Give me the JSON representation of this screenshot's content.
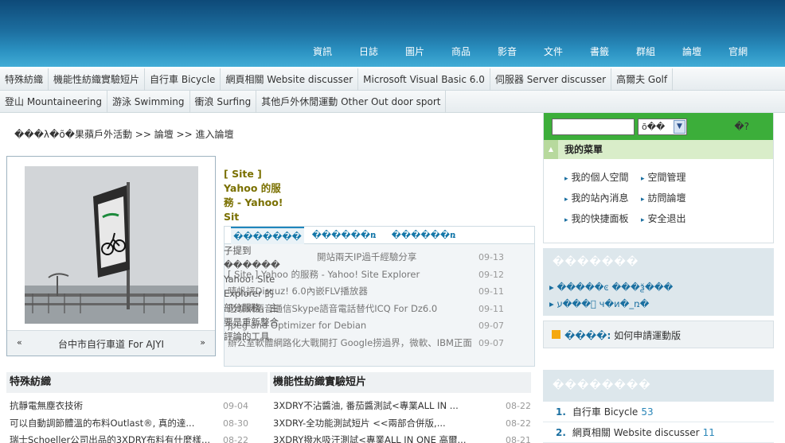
{
  "topnav": [
    "資訊",
    "日誌",
    "圖片",
    "商品",
    "影音",
    "文件",
    "書籤",
    "群組",
    "論壇",
    "官網"
  ],
  "categories_row1": [
    "特殊紡織",
    "機能性紡織實驗短片",
    "自行車 Bicycle",
    "網頁相關 Website discusser",
    "Microsoft Visual Basic 6.0",
    "伺服器 Server discusser",
    "高爾夫 Golf"
  ],
  "categories_row2": [
    "登山 Mountaineering",
    "游泳 Swimming",
    "衝浪 Surfing",
    "其他戶外休閒運動 Other Out door sport"
  ],
  "breadcrumb": "���λ�õ�果蘋戶外活動 >> 論壇 >> 進入論壇",
  "slideshow": {
    "prev": "«",
    "next": "»",
    "caption": "台中市自行車道 For AJYI"
  },
  "featured": {
    "line1": "[ Site ]",
    "line2": "Yahoo 的服",
    "line3": "務 - Yahoo!",
    "line4": "Sit"
  },
  "tabbox": {
    "tabs": [
      "�������",
      "������ռ",
      "������ռ"
    ],
    "overlap": [
      "子提到������",
      "Yahoo! Site",
      "Explorer 的",
      "部分服務，主",
      "要是重新整合",
      "評論的工具"
    ],
    "items": [
      {
        "title": "開站兩天IP過千經驗分享",
        "date": "09-13"
      },
      {
        "title": "[ Site ] Yahoo 的服務 - Yahoo! Site Explorer",
        "date": "09-12"
      },
      {
        "title": "晴帆評Discuz! 6.0內嵌FLV播放器",
        "date": "09-11"
      },
      {
        "title": "迅聊網語音通信Skype語音電話替代ICQ For Dz6.0",
        "date": "09-11"
      },
      {
        "title": "Jpeg and Optimizer for Debian",
        "date": "09-07"
      },
      {
        "title": "辦公室軟體網路化大戰開打 Google捞過界，微軟、IBM正面",
        "date": "09-07"
      }
    ]
  },
  "list_left": {
    "header": "特殊紡織",
    "items": [
      {
        "title": "抗靜電無塵衣技術",
        "date": "09-04"
      },
      {
        "title": "可以自動調節體溫的布料Outlast®, 真的達...",
        "date": "08-30"
      },
      {
        "title": "瑞士Schoeller公司出品的3XDRY布料有什麼樣...",
        "date": "08-22"
      }
    ]
  },
  "list_right": {
    "header": "機能性紡織實驗短片",
    "items": [
      {
        "title": "3XDRY不沾醬油, 番茄醬測試<專業ALL IN ...",
        "date": "08-22"
      },
      {
        "title": "3XDRY-全功能測試短片 <<兩部合併版,...",
        "date": "08-22"
      },
      {
        "title": "3XDRY撥水吸汗測試<專業ALL IN ONE 高爾...",
        "date": "08-21"
      }
    ]
  },
  "sidebar": {
    "search_select": "õ��",
    "search_q": "�?",
    "menu_title": "我的菜單",
    "menu_items": [
      "我的個人空間",
      "空間管理",
      "我的站內消息",
      "訪問論壇",
      "我的快捷面板",
      "安全退出"
    ],
    "box2_title": "�������",
    "box2_line1": "�����ͼ ���ѯ���",
    "box2_line2": "ע���ͬ ч�и�_ռ�",
    "notice_hl": "����:",
    "notice_text": " 如何申請運動版",
    "box4_title": "��������",
    "ranking": [
      {
        "n": "1.",
        "name": "自行車 Bicycle",
        "count": "53"
      },
      {
        "n": "2.",
        "name": "網頁相關 Website discusser",
        "count": "11"
      }
    ]
  },
  "colors": {
    "header_top": "#0e4a78",
    "header_bottom": "#41acd6",
    "search_bar": "#3cae3a",
    "link_blue": "#1a6fa0",
    "featured_gold": "#7a7000"
  }
}
